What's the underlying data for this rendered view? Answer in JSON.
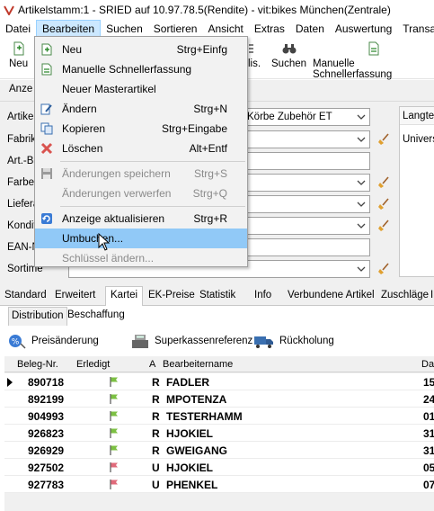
{
  "window": {
    "title": "Artikelstamm:1 - SRIED auf 10.97.78.5(Rendite) - vit:bikes München(Zentrale)"
  },
  "menubar": [
    "Datei",
    "Bearbeiten",
    "Suchen",
    "Sortieren",
    "Ansicht",
    "Extras",
    "Daten",
    "Auswertung",
    "Transa"
  ],
  "toolbar": {
    "new_label": "Neu",
    "dis_label": "lis.",
    "search_label": "Suchen",
    "quick_label": "Manuelle Schnellerfassung"
  },
  "subbar": {
    "tab": "Anze"
  },
  "form": {
    "labels": [
      "Artikel",
      "Fabrik",
      "Art.-B",
      "Farbe",
      "Liefera",
      "Kondit",
      "EAN-N",
      "Sortime"
    ],
    "category_value": "Körbe Zubehör ET",
    "lang_header": "Langte",
    "lang_value": "Univers"
  },
  "tabs": [
    "Standard",
    "Erweitert",
    "Kartei",
    "EK-Preise",
    "Statistik",
    "Info",
    "Verbundene Artikel",
    "Zuschläge",
    "I"
  ],
  "subtabs": [
    "Distribution",
    "Beschaffung"
  ],
  "actions": [
    "Preisänderung",
    "Superkassenreferenz",
    "Rückholung"
  ],
  "grid": {
    "headers": [
      "Beleg-Nr.",
      "Erledigt",
      "A",
      "Bearbeitername",
      "Da"
    ],
    "rows": [
      {
        "nr": "890718",
        "flag": "green",
        "a": "R",
        "name": "FADLER",
        "da": "15"
      },
      {
        "nr": "892199",
        "flag": "green",
        "a": "R",
        "name": "MPOTENZA",
        "da": "24"
      },
      {
        "nr": "904993",
        "flag": "green",
        "a": "R",
        "name": "TESTERHAMM",
        "da": "01"
      },
      {
        "nr": "926823",
        "flag": "green",
        "a": "R",
        "name": "HJOKIEL",
        "da": "31"
      },
      {
        "nr": "926929",
        "flag": "green",
        "a": "R",
        "name": "GWEIGANG",
        "da": "31"
      },
      {
        "nr": "927502",
        "flag": "red",
        "a": "U",
        "name": "HJOKIEL",
        "da": "05"
      },
      {
        "nr": "927783",
        "flag": "red",
        "a": "U",
        "name": "PHENKEL",
        "da": "07"
      }
    ]
  },
  "menu": {
    "items": [
      {
        "label": "Neu",
        "shortcut": "Strg+Einfg",
        "icon": "new-doc-icon",
        "disabled": false
      },
      {
        "label": "Manuelle Schnellerfassung",
        "shortcut": "",
        "icon": "quick-entry-icon",
        "disabled": false
      },
      {
        "label": "Neuer Masterartikel",
        "shortcut": "",
        "icon": "",
        "disabled": false
      },
      {
        "label": "Ändern",
        "shortcut": "Strg+N",
        "icon": "edit-icon",
        "disabled": false
      },
      {
        "label": "Kopieren",
        "shortcut": "Strg+Eingabe",
        "icon": "copy-icon",
        "disabled": false
      },
      {
        "label": "Löschen",
        "shortcut": "Alt+Entf",
        "icon": "delete-icon",
        "disabled": false
      },
      {
        "label": "Änderungen speichern",
        "shortcut": "Strg+S",
        "icon": "save-icon",
        "disabled": true
      },
      {
        "label": "Änderungen verwerfen",
        "shortcut": "Strg+Q",
        "icon": "",
        "disabled": true
      },
      {
        "label": "Anzeige aktualisieren",
        "shortcut": "Strg+R",
        "icon": "refresh-icon",
        "disabled": false
      },
      {
        "label": "Umbuchen...",
        "shortcut": "",
        "icon": "",
        "disabled": false,
        "highlighted": true
      },
      {
        "label": "Schlüssel ändern...",
        "shortcut": "",
        "icon": "",
        "disabled": true
      }
    ]
  }
}
